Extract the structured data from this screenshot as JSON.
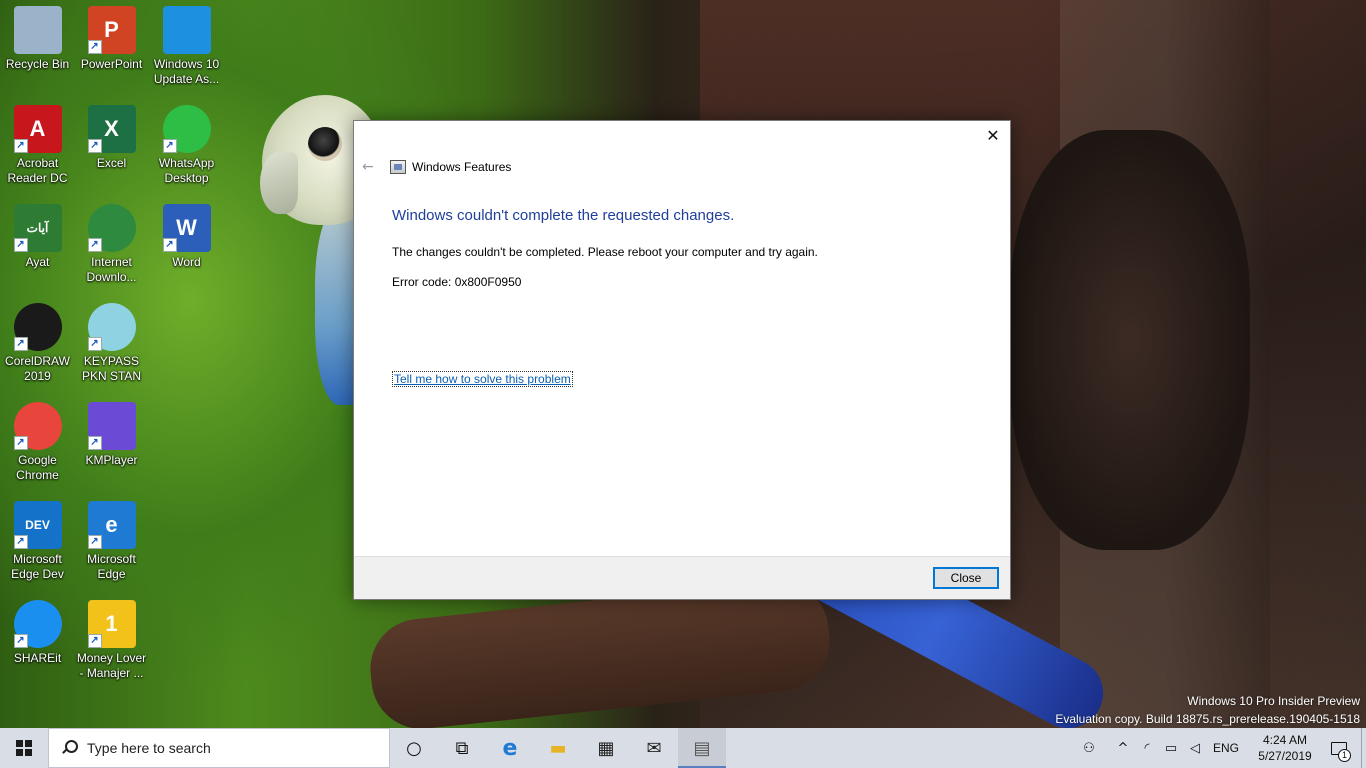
{
  "desktop": {
    "icons": [
      {
        "label": "Recycle Bin",
        "icon": "recycle-bin-icon",
        "color": "#9bb3c9"
      },
      {
        "label": "PowerPoint",
        "icon": "powerpoint-icon",
        "color": "#d04423",
        "glyph": "P"
      },
      {
        "label": "Windows 10 Update As...",
        "icon": "windows-update-icon",
        "color": "#1e90e0"
      },
      {
        "label": "Acrobat Reader DC",
        "icon": "acrobat-icon",
        "color": "#c8161d",
        "glyph": "A"
      },
      {
        "label": "Excel",
        "icon": "excel-icon",
        "color": "#1d7044",
        "glyph": "X"
      },
      {
        "label": "WhatsApp Desktop",
        "icon": "whatsapp-icon",
        "color": "#2fbe45"
      },
      {
        "label": "Ayat",
        "icon": "ayat-icon",
        "color": "#2e7b34",
        "glyph": "آيات"
      },
      {
        "label": "Internet Downlo...",
        "icon": "internet-download-manager-icon",
        "color": "#2d8a3e"
      },
      {
        "label": "Word",
        "icon": "word-icon",
        "color": "#2b5fb9",
        "glyph": "W"
      },
      {
        "label": "CorelDRAW 2019",
        "icon": "coreldraw-icon",
        "color": "#1a1a1a"
      },
      {
        "label": "KEYPASS PKN STAN",
        "icon": "keypass-icon",
        "color": "#8fd3e3"
      },
      {
        "label": "Google Chrome",
        "icon": "chrome-icon",
        "color": "#e8453c"
      },
      {
        "label": "KMPlayer",
        "icon": "kmplayer-icon",
        "color": "#6b4ad6"
      },
      {
        "label": "Microsoft Edge Dev",
        "icon": "edge-dev-icon",
        "color": "#1572c9",
        "glyph": "DEV"
      },
      {
        "label": "Microsoft Edge",
        "icon": "edge-icon",
        "color": "#1f7ad3",
        "glyph": "e"
      },
      {
        "label": "SHAREit",
        "icon": "shareit-icon",
        "color": "#1b8ff0"
      },
      {
        "label": "Money Lover - Manajer ...",
        "icon": "money-lover-icon",
        "color": "#f2c21b",
        "glyph": "1"
      }
    ]
  },
  "dialog": {
    "nav_title": "Windows Features",
    "heading": "Windows couldn't complete the requested changes.",
    "message": "The changes couldn't be completed. Please reboot your computer and try again.",
    "error_code": "Error code: 0x800F0950",
    "help_link": "Tell me how to solve this problem",
    "close_button": "Close",
    "heading_color": "#1f3f9b",
    "link_color": "#0b5fb2"
  },
  "watermark": {
    "line1": "Windows 10 Pro Insider Preview",
    "line2": "Evaluation copy. Build 18875.rs_prerelease.190405-1518"
  },
  "taskbar": {
    "search_placeholder": "Type here to search",
    "pinned": [
      {
        "icon": "cortana-icon"
      },
      {
        "icon": "task-view-icon"
      },
      {
        "icon": "edge-icon"
      },
      {
        "icon": "file-explorer-icon"
      },
      {
        "icon": "store-icon"
      },
      {
        "icon": "mail-icon"
      },
      {
        "icon": "windows-features-icon",
        "active": true
      }
    ],
    "tray": {
      "language": "ENG",
      "time": "4:24 AM",
      "date": "5/27/2019",
      "notification_count": "1"
    }
  }
}
